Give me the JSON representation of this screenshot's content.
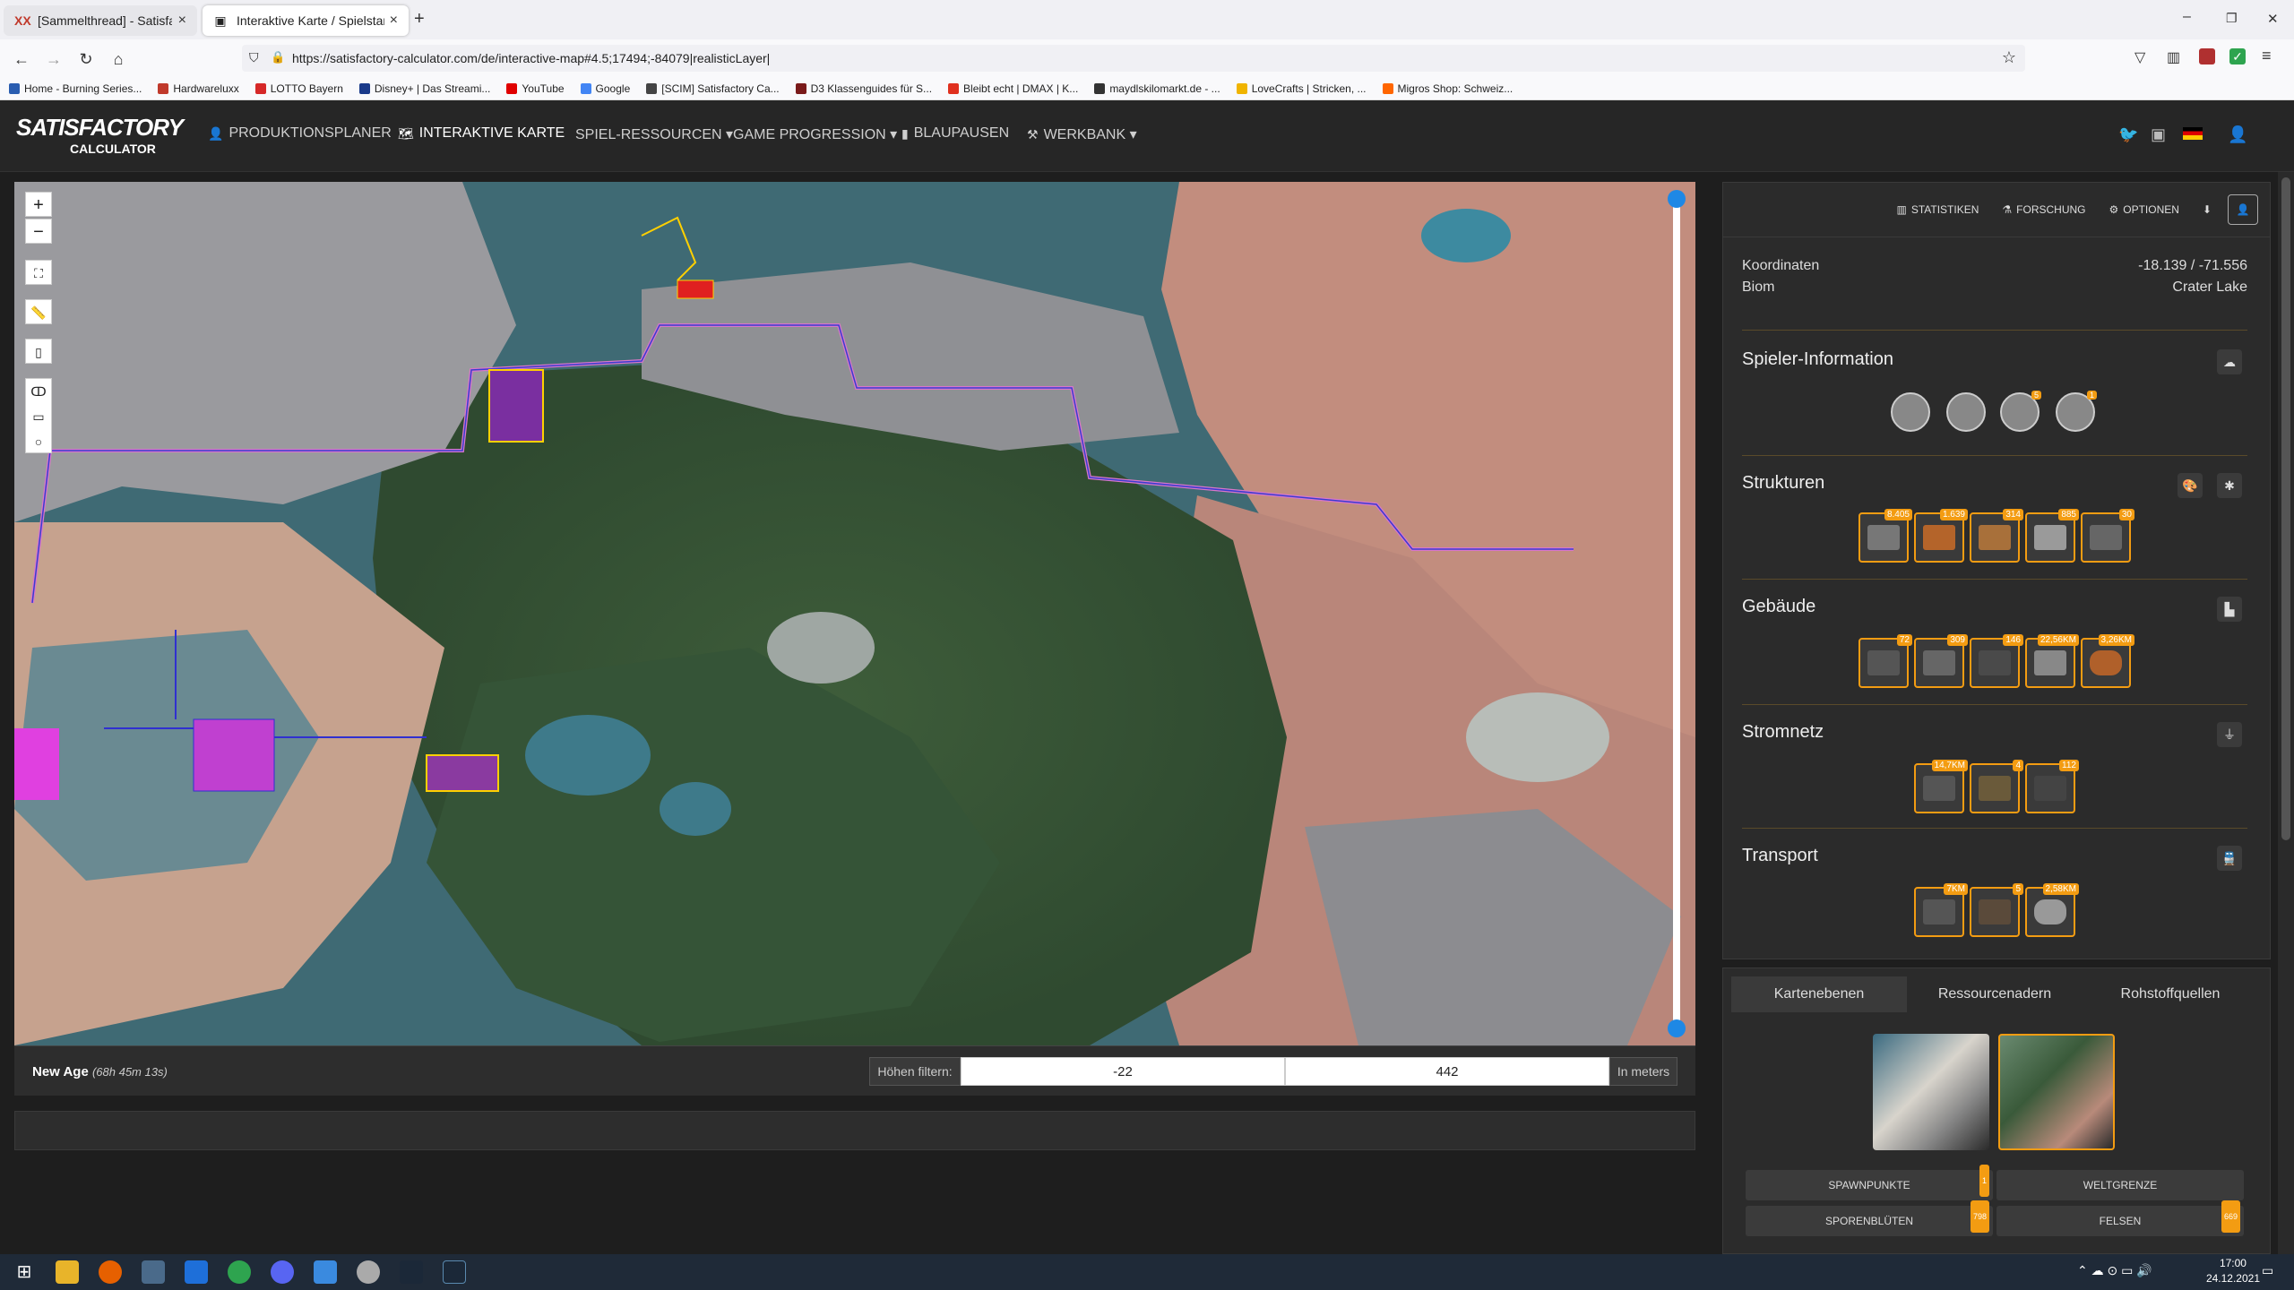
{
  "browser": {
    "tabs": [
      {
        "title": "[Sammelthread] - Satisfactory |",
        "active": false
      },
      {
        "title": "Interaktive Karte / Spielstand Ed",
        "active": true
      }
    ],
    "new_tab": "+",
    "url": "https://satisfactory-calculator.com/de/interactive-map#4.5;17494;-84079|realisticLayer|",
    "window_controls": {
      "minimize": "–",
      "maximize": "❐",
      "close": "✕"
    },
    "bookmarks": [
      {
        "label": "Home - Burning Series...",
        "color": "#2a5db0"
      },
      {
        "label": "Hardwareluxx",
        "color": "#c0392b"
      },
      {
        "label": "LOTTO Bayern",
        "color": "#d62828"
      },
      {
        "label": "Disney+ | Das Streami...",
        "color": "#1a3a8a"
      },
      {
        "label": "YouTube",
        "color": "#e00000"
      },
      {
        "label": "Google",
        "color": "#4285f4"
      },
      {
        "label": "[SCIM] Satisfactory Ca...",
        "color": "#444444"
      },
      {
        "label": "D3 Klassenguides für S...",
        "color": "#7a1a1a"
      },
      {
        "label": "Bleibt echt | DMAX | K...",
        "color": "#e0301e"
      },
      {
        "label": "maydlskilomarkt.de - ...",
        "color": "#333333"
      },
      {
        "label": "LoveCrafts | Stricken, ...",
        "color": "#f0b400"
      },
      {
        "label": "Migros Shop: Schweiz...",
        "color": "#ff6600"
      }
    ]
  },
  "app": {
    "logo_top": "SATISFACTORY",
    "logo_bottom": "CALCULATOR",
    "nav": [
      {
        "label": "PRODUKTIONSPLANER",
        "icon": "person-icon"
      },
      {
        "label": "INTERAKTIVE KARTE",
        "icon": "map-icon"
      },
      {
        "label": "SPIEL-RESSOURCEN ▾",
        "icon": ""
      },
      {
        "label": "GAME PROGRESSION ▾",
        "icon": ""
      },
      {
        "label": "BLAUPAUSEN",
        "icon": "blueprint-icon"
      },
      {
        "label": "WERKBANK ▾",
        "icon": "hammer-icon"
      }
    ],
    "right_icons": [
      "twitter-icon",
      "discord-icon",
      "flag-de-icon",
      "user-icon"
    ]
  },
  "map": {
    "controls": {
      "zoom_in": "+",
      "zoom_out": "−"
    },
    "world_name": "New Age",
    "play_time": "(68h 45m 13s)",
    "height_filter_label": "Höhen filtern:",
    "height_min": "-22",
    "height_max": "442",
    "height_unit": "In meters"
  },
  "panel": {
    "toolbar": [
      {
        "label": "STATISTIKEN",
        "icon": "chart-icon"
      },
      {
        "label": "FORSCHUNG",
        "icon": "flask-icon"
      },
      {
        "label": "OPTIONEN",
        "icon": "gear-icon"
      }
    ],
    "coords_label": "Koordinaten",
    "coords_value": "-18.139 / -71.556",
    "biome_label": "Biom",
    "biome_value": "Crater Lake",
    "sections": {
      "player": {
        "title": "Spieler-Information",
        "badges": [
          "",
          "",
          "5",
          "1"
        ]
      },
      "structures": {
        "title": "Strukturen",
        "badges": [
          "8.405",
          "1.639",
          "314",
          "885",
          "30"
        ]
      },
      "buildings": {
        "title": "Gebäude",
        "badges": [
          "72",
          "309",
          "146",
          "22,56KM",
          "3,26KM"
        ]
      },
      "power": {
        "title": "Stromnetz",
        "badges": [
          "14,7KM",
          "4",
          "112"
        ]
      },
      "transport": {
        "title": "Transport",
        "badges": [
          "7KM",
          "5",
          "2,58KM"
        ]
      }
    },
    "layer_tabs": [
      "Kartenebenen",
      "Ressourcenadern",
      "Rohstoffquellen"
    ],
    "layer_buttons": [
      {
        "label": "SPAWNPUNKTE",
        "badge": "1"
      },
      {
        "label": "WELTGRENZE",
        "badge": ""
      },
      {
        "label": "SPORENBLÜTEN",
        "badge": "798"
      },
      {
        "label": "FELSEN",
        "badge": "669"
      }
    ]
  },
  "taskbar": {
    "time": "17:00",
    "date": "24.12.2021"
  }
}
